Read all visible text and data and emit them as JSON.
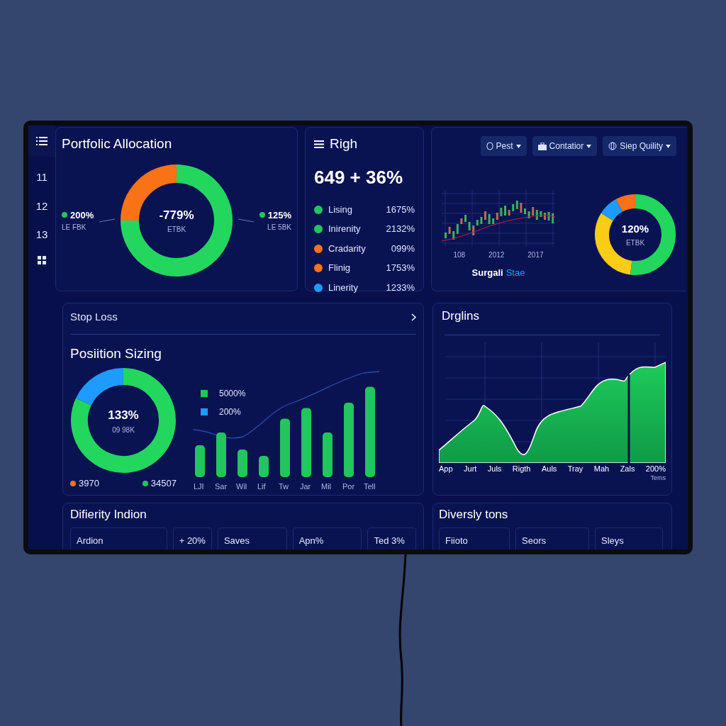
{
  "sidebar": {
    "items": [
      {
        "label": "11"
      },
      {
        "label": "12"
      },
      {
        "label": "13"
      }
    ]
  },
  "allocation_panel": {
    "title": "Portfolic Allocation",
    "center_value": "-779%",
    "center_label": "ETBK",
    "left": {
      "value": "200%",
      "label": "LE FBK",
      "color": "#22c55e"
    },
    "right": {
      "value": "125%",
      "label": "LE 5BK",
      "color": "#22c55e"
    }
  },
  "risk_panel": {
    "title": "Righ",
    "headline": "649 + 36%",
    "items": [
      {
        "name": "Lising",
        "value": "1675%",
        "color": "#22c55e"
      },
      {
        "name": "Inirenity",
        "value": "2132%",
        "color": "#22c55e"
      },
      {
        "name": "Cradarity",
        "value": "099%",
        "color": "#f97316"
      },
      {
        "name": "Flinig",
        "value": "1753%",
        "color": "#f97316"
      },
      {
        "name": "Linerity",
        "value": "1233%",
        "color": "#1e9bff"
      }
    ]
  },
  "market_panel": {
    "buttons": [
      {
        "label": "Pest"
      },
      {
        "label": "Contatior"
      },
      {
        "label": "Siep Quility"
      }
    ],
    "chart_labels": [
      "108",
      "2012",
      "2017"
    ],
    "caption": "Surgali",
    "caption_accent": "Stae",
    "donut_value": "120%",
    "donut_label": "ETBK"
  },
  "sizing_panel": {
    "row_label": "Stop Loss",
    "title": "Posiition Sizing",
    "donut_value": "133%",
    "donut_label": "09 98K",
    "donut_legend": [
      {
        "value": "3970",
        "color": "#f97316"
      },
      {
        "value": "34507",
        "color": "#22c55e"
      }
    ],
    "bar_legend": [
      {
        "value": "5000%",
        "color": "#22c55e"
      },
      {
        "value": "200%",
        "color": "#1e9bff"
      }
    ],
    "bar_labels": [
      "LJI",
      "Sar",
      "Wil",
      "Lif",
      "Tw",
      "Jar",
      "Mil",
      "Por",
      "Tell"
    ]
  },
  "drawdown_panel": {
    "title": "Drglins",
    "x_labels": [
      "App",
      "Jurt",
      "Juls",
      "Rigth",
      "Auls",
      "Tray",
      "Mah",
      "Zals",
      "200%"
    ],
    "note": "Tems"
  },
  "bottom_left": {
    "title": "Difierity Indion",
    "cells": [
      "Ardion",
      "+ 20%",
      "Saves",
      "Apn%",
      "Ted 3%"
    ]
  },
  "bottom_right": {
    "title": "Diversly tons",
    "cells": [
      "Fiioto",
      "Seors",
      "Sleys"
    ]
  }
}
